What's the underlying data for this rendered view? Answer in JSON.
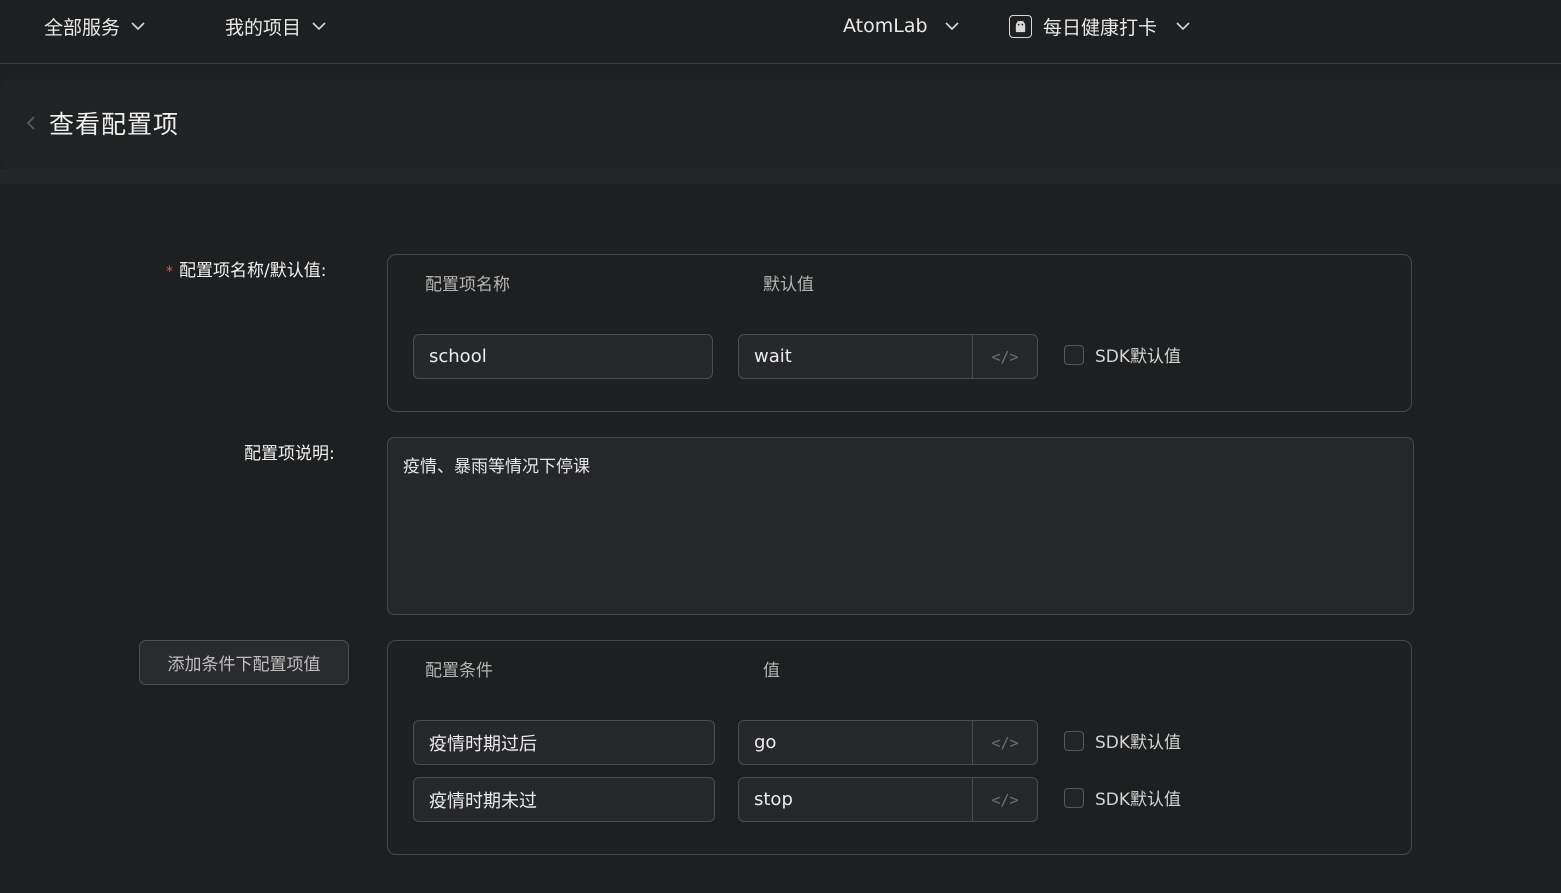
{
  "topbar": {
    "all_services": "全部服务",
    "my_projects": "我的项目",
    "org": "AtomLab",
    "app": "每日健康打卡"
  },
  "page": {
    "title": "查看配置项"
  },
  "form": {
    "name_default_label": "配置项名称/默认值:",
    "required_mark": "*",
    "description_label": "配置项说明:",
    "name_panel": {
      "col_name": "配置项名称",
      "col_default": "默认值",
      "name_value": "school",
      "default_value": "wait",
      "code_symbol": "</>",
      "sdk_default_label": "SDK默认值"
    },
    "description_value": "疫情、暴雨等情况下停课",
    "add_condition_button": "添加条件下配置项值",
    "condition_panel": {
      "col_condition": "配置条件",
      "col_value": "值",
      "rows": [
        {
          "condition": "疫情时期过后",
          "value": "go",
          "code_symbol": "</>",
          "sdk_default_label": "SDK默认值"
        },
        {
          "condition": "疫情时期未过",
          "value": "stop",
          "code_symbol": "</>",
          "sdk_default_label": "SDK默认值"
        }
      ]
    }
  },
  "colors": {
    "background": "#1e1f20",
    "required": "#e05a5a",
    "border": "#45474a"
  },
  "icons": [
    "chevron-down-icon",
    "android-app-icon",
    "back-arrow-icon",
    "code-icon",
    "checkbox-icon"
  ]
}
